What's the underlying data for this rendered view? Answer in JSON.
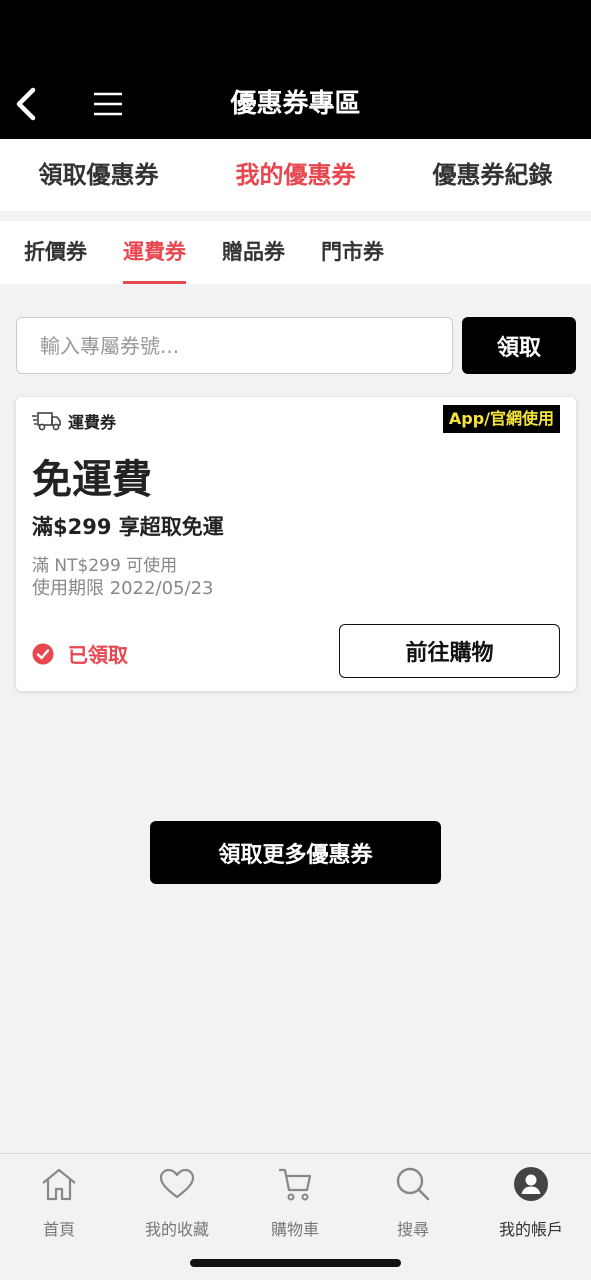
{
  "header": {
    "title": "優惠券專區",
    "back_icon": "chevron-left-icon",
    "menu_icon": "hamburger-menu-icon"
  },
  "main_tabs": [
    {
      "label": "領取優惠券",
      "active": false
    },
    {
      "label": "我的優惠券",
      "active": true
    },
    {
      "label": "優惠券紀錄",
      "active": false
    }
  ],
  "sub_tabs": [
    {
      "label": "折價券",
      "active": false
    },
    {
      "label": "運費券",
      "active": true
    },
    {
      "label": "贈品券",
      "active": false
    },
    {
      "label": "門市券",
      "active": false
    }
  ],
  "code_entry": {
    "placeholder": "輸入專屬券號...",
    "value": "",
    "button_label": "領取"
  },
  "coupon": {
    "type_icon": "truck-icon",
    "type_label": "運費券",
    "channel_badge": "App/官網使用",
    "title": "免運費",
    "description": "滿$299 享超取免運",
    "min_spend": "滿 NT$299 可使用",
    "expiry": "使用期限 2022/05/23",
    "status_icon": "check-circle-icon",
    "status_label": "已領取",
    "action_label": "前往購物"
  },
  "more_button_label": "領取更多優惠券",
  "bottom_nav": [
    {
      "label": "首頁",
      "icon": "home-icon",
      "active": false
    },
    {
      "label": "我的收藏",
      "icon": "heart-icon",
      "active": false
    },
    {
      "label": "購物車",
      "icon": "cart-icon",
      "active": false
    },
    {
      "label": "搜尋",
      "icon": "search-icon",
      "active": false
    },
    {
      "label": "我的帳戶",
      "icon": "account-icon",
      "active": true
    }
  ],
  "colors": {
    "accent": "#e8474f",
    "header_bg": "#000000",
    "badge_text": "#f5e43a",
    "page_bg": "#f2f2f2"
  }
}
